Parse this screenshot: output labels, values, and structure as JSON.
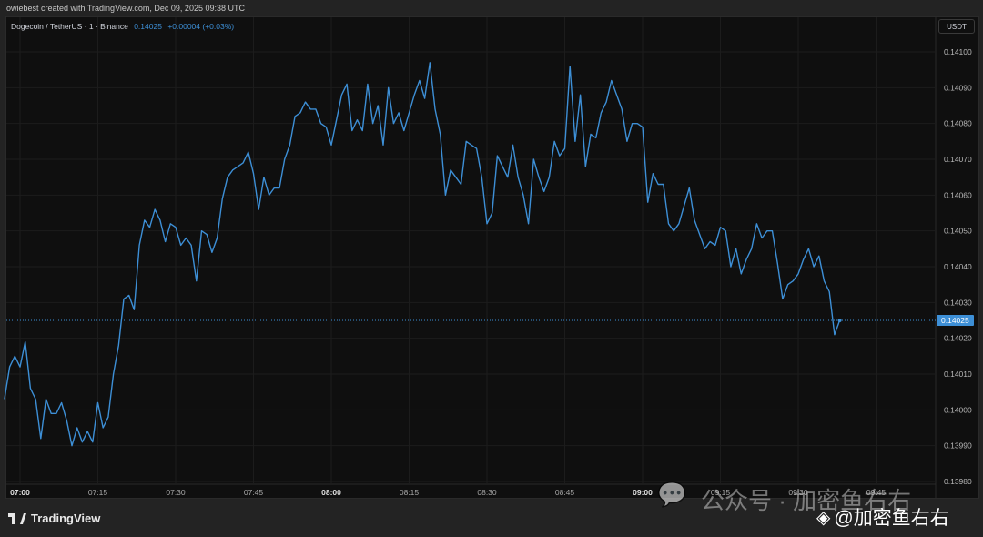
{
  "credit": "owiebest created with TradingView.com, Dec 09, 2025 09:38 UTC",
  "legend": {
    "symbol": "Dogecoin / TetherUS · 1 · Binance",
    "price": "0.14025",
    "change": "+0.00004 (+0.03%)"
  },
  "unit": "USDT",
  "footer": {
    "brand": "TradingView"
  },
  "watermark": {
    "channel": "公众号 · 加密鱼右右",
    "handle": "@加密鱼右右"
  },
  "colors": {
    "line": "#3d8fd6",
    "background": "#0f0f0f",
    "grid": "#1c1c1c"
  },
  "chart_data": {
    "type": "line",
    "title": "Dogecoin / TetherUS · 1 · Binance",
    "x_start": "06:57",
    "x_interval_minutes": 1,
    "x_ticks": [
      "07:00",
      "07:15",
      "07:30",
      "07:45",
      "08:00",
      "08:15",
      "08:30",
      "08:45",
      "09:00",
      "09:15",
      "09:30",
      "09:45"
    ],
    "x_ticks_bold": [
      "07:00",
      "08:00",
      "09:00"
    ],
    "y_ticks": [
      "0.14100",
      "0.14090",
      "0.14080",
      "0.14070",
      "0.14060",
      "0.14050",
      "0.14040",
      "0.14030",
      "0.14020",
      "0.14010",
      "0.14000",
      "0.13990",
      "0.13980"
    ],
    "ylim": [
      0.1398,
      0.141
    ],
    "last_price": 0.14025,
    "last_price_label": "0.14025",
    "grid": true,
    "values": [
      0.14003,
      0.14012,
      0.14015,
      0.14012,
      0.14019,
      0.14006,
      0.14003,
      0.13992,
      0.14003,
      0.13999,
      0.13999,
      0.14002,
      0.13997,
      0.1399,
      0.13995,
      0.13991,
      0.13994,
      0.13991,
      0.14002,
      0.13995,
      0.13998,
      0.1401,
      0.14018,
      0.14031,
      0.14032,
      0.14028,
      0.14046,
      0.14053,
      0.14051,
      0.14056,
      0.14053,
      0.14047,
      0.14052,
      0.14051,
      0.14046,
      0.14048,
      0.14046,
      0.14036,
      0.1405,
      0.14049,
      0.14044,
      0.14048,
      0.14059,
      0.14065,
      0.14067,
      0.14068,
      0.14069,
      0.14072,
      0.14066,
      0.14056,
      0.14065,
      0.1406,
      0.14062,
      0.14062,
      0.1407,
      0.14074,
      0.14082,
      0.14083,
      0.14086,
      0.14084,
      0.14084,
      0.1408,
      0.14079,
      0.14074,
      0.14081,
      0.14088,
      0.14091,
      0.14078,
      0.14081,
      0.14078,
      0.14091,
      0.1408,
      0.14085,
      0.14074,
      0.1409,
      0.1408,
      0.14083,
      0.14078,
      0.14083,
      0.14088,
      0.14092,
      0.14087,
      0.14097,
      0.14084,
      0.14077,
      0.1406,
      0.14067,
      0.14065,
      0.14063,
      0.14075,
      0.14074,
      0.14073,
      0.14065,
      0.14052,
      0.14055,
      0.14071,
      0.14068,
      0.14065,
      0.14074,
      0.14065,
      0.1406,
      0.14052,
      0.1407,
      0.14065,
      0.14061,
      0.14065,
      0.14075,
      0.14071,
      0.14073,
      0.14096,
      0.14075,
      0.14088,
      0.14068,
      0.14077,
      0.14076,
      0.14083,
      0.14086,
      0.14092,
      0.14088,
      0.14084,
      0.14075,
      0.1408,
      0.1408,
      0.14079,
      0.14058,
      0.14066,
      0.14063,
      0.14063,
      0.14052,
      0.1405,
      0.14052,
      0.14057,
      0.14062,
      0.14053,
      0.14049,
      0.14045,
      0.14047,
      0.14046,
      0.14051,
      0.1405,
      0.1404,
      0.14045,
      0.14038,
      0.14042,
      0.14045,
      0.14052,
      0.14048,
      0.1405,
      0.1405,
      0.14041,
      0.14031,
      0.14035,
      0.14036,
      0.14038,
      0.14042,
      0.14045,
      0.1404,
      0.14043,
      0.14036,
      0.14033,
      0.14021,
      0.14025
    ]
  }
}
